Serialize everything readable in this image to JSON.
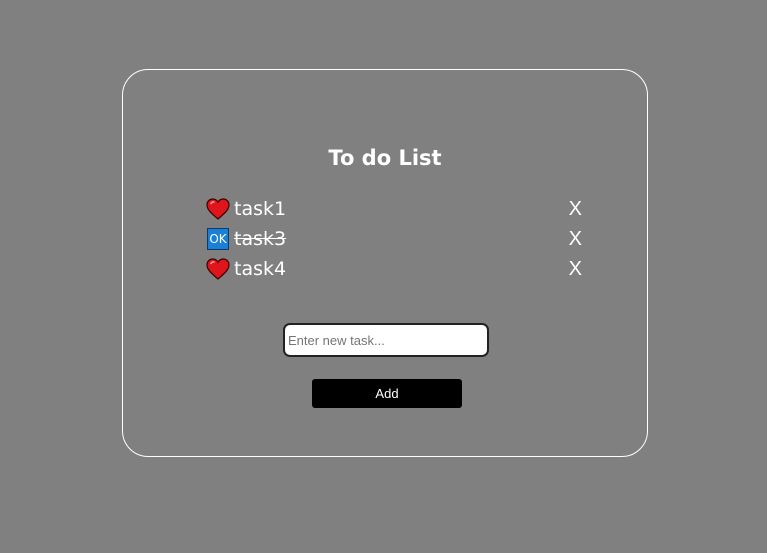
{
  "app": {
    "title": "To do List"
  },
  "tasks": [
    {
      "label": "task1",
      "done": false,
      "status_icon": "heart-icon",
      "delete_label": "X"
    },
    {
      "label": "task3",
      "done": true,
      "status_icon": "ok-icon",
      "status_text": "OK",
      "delete_label": "X"
    },
    {
      "label": "task4",
      "done": false,
      "status_icon": "heart-icon",
      "delete_label": "X"
    }
  ],
  "form": {
    "input_value": "",
    "input_placeholder": "Enter new task...",
    "add_label": "Add"
  },
  "colors": {
    "background": "#808080",
    "text": "#ffffff",
    "button": "#000000",
    "heart": "#e0141b",
    "ok_badge": "#1a7fd6"
  }
}
